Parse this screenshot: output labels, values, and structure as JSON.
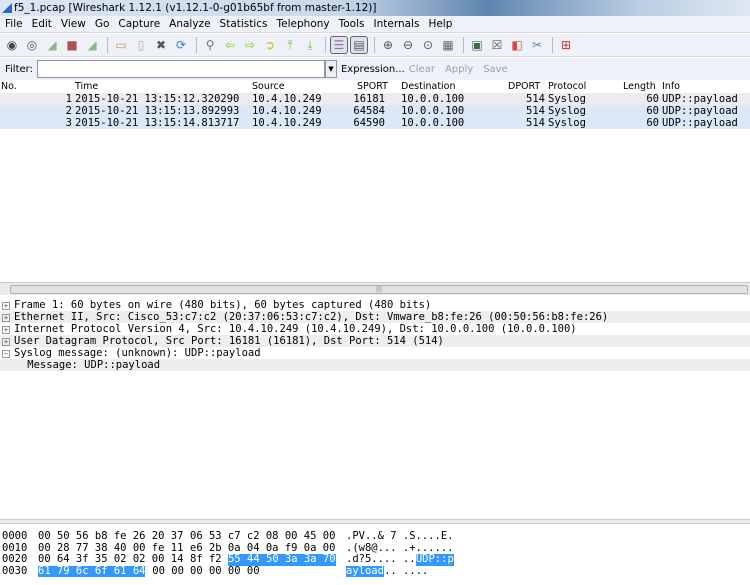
{
  "window": {
    "title": "f5_1.pcap   [Wireshark 1.12.1  (v1.12.1-0-g01b65bf from master-1.12)]"
  },
  "menu": [
    "File",
    "Edit",
    "View",
    "Go",
    "Capture",
    "Analyze",
    "Statistics",
    "Telephony",
    "Tools",
    "Internals",
    "Help"
  ],
  "filter": {
    "label": "Filter:",
    "value": "",
    "expression": "Expression...",
    "clear": "Clear",
    "apply": "Apply",
    "save": "Save"
  },
  "columns": {
    "no": "No.",
    "time": "Time",
    "source": "Source",
    "sport": "SPORT",
    "destination": "Destination",
    "dport": "DPORT",
    "protocol": "Protocol",
    "length": "Length",
    "info": "Info"
  },
  "packets": [
    {
      "no": "1",
      "time": "2015-10-21 13:15:12.320290",
      "source": "10.4.10.249",
      "sport": "16181",
      "destination": "10.0.0.100",
      "dport": "514",
      "protocol": "Syslog",
      "length": "60",
      "info": "UDP::payload"
    },
    {
      "no": "2",
      "time": "2015-10-21 13:15:13.892993",
      "source": "10.4.10.249",
      "sport": "64584",
      "destination": "10.0.0.100",
      "dport": "514",
      "protocol": "Syslog",
      "length": "60",
      "info": "UDP::payload"
    },
    {
      "no": "3",
      "time": "2015-10-21 13:15:14.813717",
      "source": "10.4.10.249",
      "sport": "64590",
      "destination": "10.0.0.100",
      "dport": "514",
      "protocol": "Syslog",
      "length": "60",
      "info": "UDP::payload"
    }
  ],
  "details": [
    {
      "exp": "+",
      "text": "Frame 1: 60 bytes on wire (480 bits), 60 bytes captured (480 bits)"
    },
    {
      "exp": "+",
      "text": "Ethernet II, Src: Cisco_53:c7:c2 (20:37:06:53:c7:c2), Dst: Vmware_b8:fe:26 (00:50:56:b8:fe:26)"
    },
    {
      "exp": "+",
      "text": "Internet Protocol Version 4, Src: 10.4.10.249 (10.4.10.249), Dst: 10.0.0.100 (10.0.0.100)"
    },
    {
      "exp": "+",
      "text": "User Datagram Protocol, Src Port: 16181 (16181), Dst Port: 514 (514)"
    },
    {
      "exp": "−",
      "text": "Syslog message: (unknown): UDP::payload"
    },
    {
      "exp": "",
      "text": "    Message: UDP::payload"
    }
  ],
  "bytes": [
    {
      "off": "0000",
      "hex_a": "00 50 56 b8 fe 26 20 37",
      "hex_b": "06 53 c7 c2 08 00 45 00",
      "hex_b_hl": "",
      "hex_a_hl": "",
      "ascii": ".PV..& 7 .S....E.",
      "ascii_pre": "",
      "ascii_hl": ""
    },
    {
      "off": "0010",
      "hex_a": "00 28 77 38 40 00 fe 11",
      "hex_b": "e6 2b 0a 04 0a f9 0a 00",
      "hex_b_hl": "",
      "hex_a_hl": "",
      "ascii": ".(w8@... .+......",
      "ascii_pre": "",
      "ascii_hl": ""
    },
    {
      "off": "0020",
      "hex_a": "00 64 3f 35 02 02 00 14",
      "hex_b": "8f f2",
      "hex_b_hl": "55 44 50 3a 3a 70",
      "hex_a_hl": "",
      "ascii": ".d?5.... ..",
      "ascii_pre": "",
      "ascii_hl": "UDP::p"
    },
    {
      "off": "0030",
      "hex_a": "",
      "hex_a_hl": "61 79 6c 6f 61 64",
      "hex_a_rest": "00 00",
      "hex_b": "00 00 00 00",
      "hex_b_hl": "",
      "ascii": "",
      "ascii_pre": "",
      "ascii_hl": "ayload",
      "ascii_rest": ".. ...."
    }
  ]
}
